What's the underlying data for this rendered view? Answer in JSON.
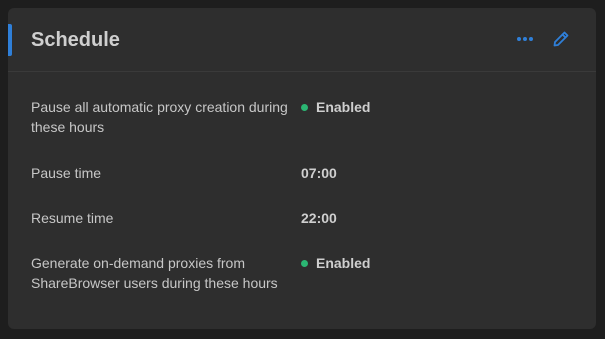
{
  "card": {
    "title": "Schedule",
    "accent_color": "#2f7fd8",
    "actions": [
      {
        "icon": "more-horizontal-icon",
        "label": "More options"
      },
      {
        "icon": "edit-pencil-icon",
        "label": "Edit"
      }
    ]
  },
  "rows": [
    {
      "label": "Pause all automatic proxy creation during these hours",
      "value": "Enabled",
      "status": "enabled",
      "status_color": "#2bb673"
    },
    {
      "label": "Pause time",
      "value": "07:00"
    },
    {
      "label": "Resume time",
      "value": "22:00"
    },
    {
      "label": "Generate on-demand proxies from ShareBrowser users during these hours",
      "value": "Enabled",
      "status": "enabled",
      "status_color": "#2bb673"
    }
  ]
}
